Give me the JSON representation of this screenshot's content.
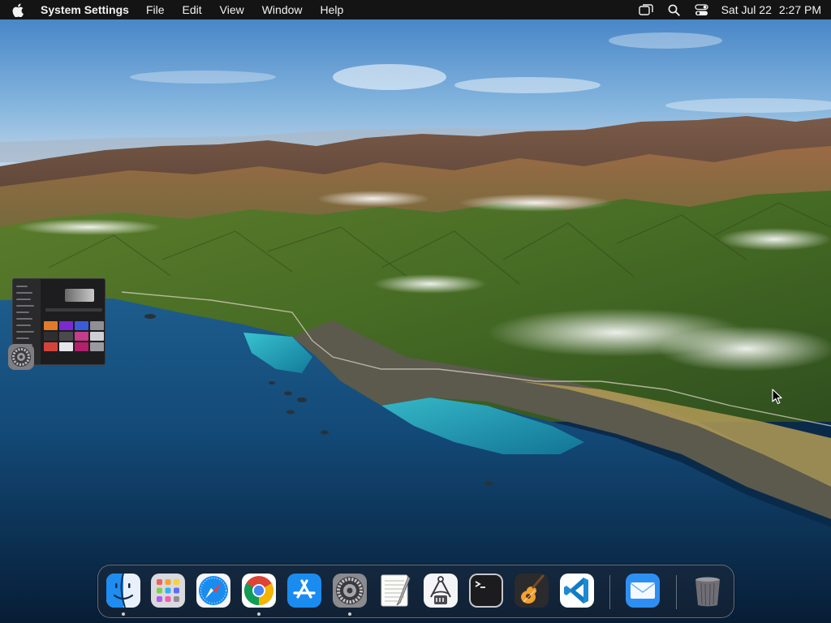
{
  "menubar": {
    "app_name": "System Settings",
    "menus": [
      "File",
      "Edit",
      "View",
      "Window",
      "Help"
    ],
    "date": "Sat Jul 22",
    "time": "2:27 PM",
    "status_icons": [
      "window-manager-icon",
      "spotlight-search-icon",
      "control-center-icon"
    ]
  },
  "minimized_window": {
    "app": "System Settings",
    "badge_icon": "system-settings-gear-icon"
  },
  "dock": {
    "apps": [
      {
        "name": "Finder",
        "icon": "finder-icon",
        "running": true
      },
      {
        "name": "Launchpad",
        "icon": "launchpad-icon",
        "running": false
      },
      {
        "name": "Safari",
        "icon": "safari-icon",
        "running": false
      },
      {
        "name": "Google Chrome",
        "icon": "chrome-icon",
        "running": true
      },
      {
        "name": "App Store",
        "icon": "app-store-icon",
        "running": false
      },
      {
        "name": "System Settings",
        "icon": "system-settings-icon",
        "running": true
      },
      {
        "name": "TextEdit",
        "icon": "textedit-icon",
        "running": false
      },
      {
        "name": "System Information",
        "icon": "system-information-icon",
        "running": false
      },
      {
        "name": "Terminal",
        "icon": "terminal-icon",
        "running": false
      },
      {
        "name": "GarageBand",
        "icon": "garageband-icon",
        "running": false
      },
      {
        "name": "Visual Studio Code",
        "icon": "vscode-icon",
        "running": false
      },
      {
        "name": "Mail",
        "icon": "mail-icon",
        "running": false
      },
      {
        "name": "Trash",
        "icon": "trash-icon",
        "running": false
      }
    ]
  },
  "colors": {
    "menubar_bg": "#141414",
    "sky_top": "#3d7fc4",
    "ocean": "#0f3f6a",
    "lagoon": "#23a5b8"
  }
}
